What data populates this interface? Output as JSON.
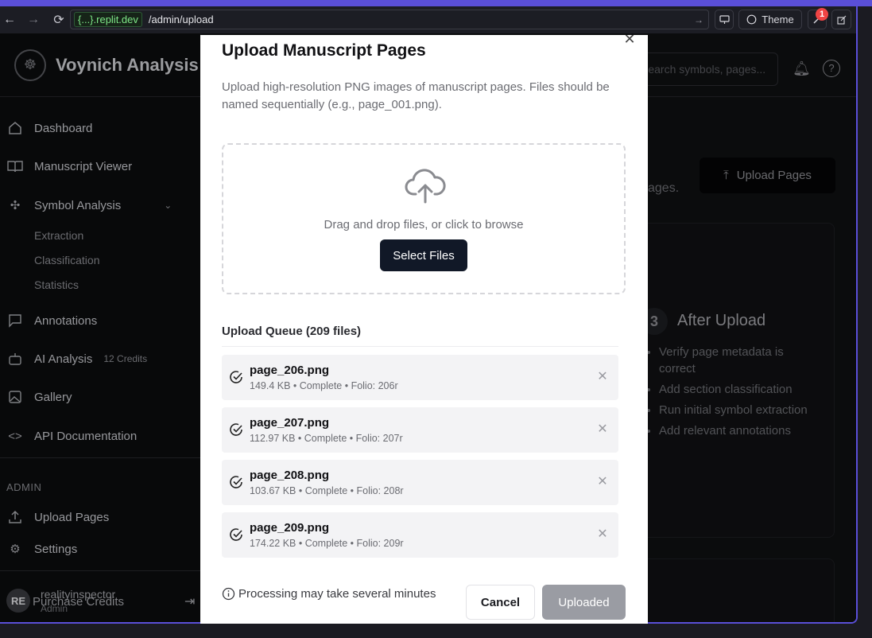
{
  "browser": {
    "domain": "{...}.replit.dev",
    "path": "/admin/upload",
    "theme_label": "Theme",
    "notification_count": "1"
  },
  "sidebar": {
    "brand": "Voynich Analysis",
    "items": [
      {
        "label": "Dashboard",
        "icon": "home-icon"
      },
      {
        "label": "Manuscript Viewer",
        "icon": "book-icon"
      },
      {
        "label": "Symbol Analysis",
        "icon": "puzzle-icon"
      },
      {
        "label": "Annotations",
        "icon": "comment-icon"
      },
      {
        "label": "AI Analysis",
        "icon": "bot-icon"
      },
      {
        "label": "Gallery",
        "icon": "image-icon"
      },
      {
        "label": "API Documentation",
        "icon": "code-icon"
      }
    ],
    "sub_items": [
      "Extraction",
      "Classification",
      "Statistics"
    ],
    "ai_credits": "12 Credits",
    "admin_label": "ADMIN",
    "admin_items": [
      {
        "label": "Upload Pages",
        "icon": "upload-icon"
      },
      {
        "label": "Settings",
        "icon": "gear-icon"
      }
    ],
    "user": {
      "initials": "RE",
      "name": "realityinspector",
      "role": "Admin",
      "purchase": "Purchase Credits"
    }
  },
  "main": {
    "search_placeholder": "Search symbols, pages...",
    "upload_button": "Upload Pages",
    "subtext": "ages.",
    "step": {
      "number": "3",
      "title": "After Upload",
      "items": [
        "Verify page metadata is correct",
        "Add section classification",
        "Run initial symbol extraction",
        "Add relevant annotations"
      ]
    }
  },
  "modal": {
    "title": "Upload Manuscript Pages",
    "description": "Upload high-resolution PNG images of manuscript pages. Files should be named sequentially (e.g., page_001.png).",
    "drop_text": "Drag and drop files, or click to browse",
    "select_button": "Select Files",
    "queue_title": "Upload Queue (209 files)",
    "queue": [
      {
        "name": "page_206.png",
        "meta": "149.4 KB • Complete • Folio: 206r"
      },
      {
        "name": "page_207.png",
        "meta": "112.97 KB • Complete • Folio: 207r"
      },
      {
        "name": "page_208.png",
        "meta": "103.67 KB • Complete • Folio: 208r"
      },
      {
        "name": "page_209.png",
        "meta": "174.22 KB • Complete • Folio: 209r"
      }
    ],
    "note": "Processing may take several minutes",
    "cancel_button": "Cancel",
    "uploaded_button": "Uploaded"
  }
}
